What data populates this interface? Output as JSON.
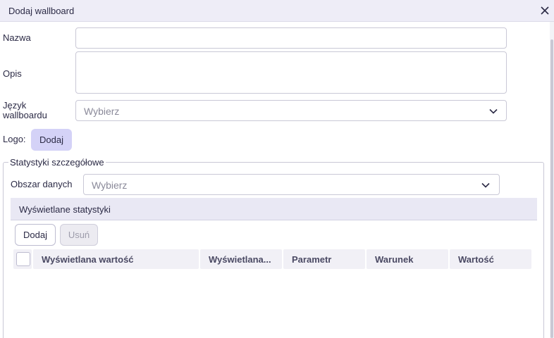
{
  "dialog": {
    "title": "Dodaj wallboard"
  },
  "form": {
    "name_label": "Nazwa",
    "name_value": "",
    "description_label": "Opis",
    "description_value": "",
    "language_label": "Język wallboardu",
    "language_value": "Wybierz",
    "logo_label": "Logo:",
    "logo_add_label": "Dodaj"
  },
  "stats": {
    "legend": "Statystyki szczegółowe",
    "area_label": "Obszar danych",
    "area_value": "Wybierz",
    "panel_title": "Wyświetlane statystyki",
    "add_label": "Dodaj",
    "delete_label": "Usuń",
    "columns": [
      "Wyświetlana wartość",
      "Wyświetlana...",
      "Parametr",
      "Warunek",
      "Wartość"
    ]
  },
  "colors": {
    "accent": "#d4d2f7",
    "header_bg": "#eeedf7"
  },
  "icons": {
    "close": "close-icon",
    "dropdown": "chevron-down-icon"
  }
}
